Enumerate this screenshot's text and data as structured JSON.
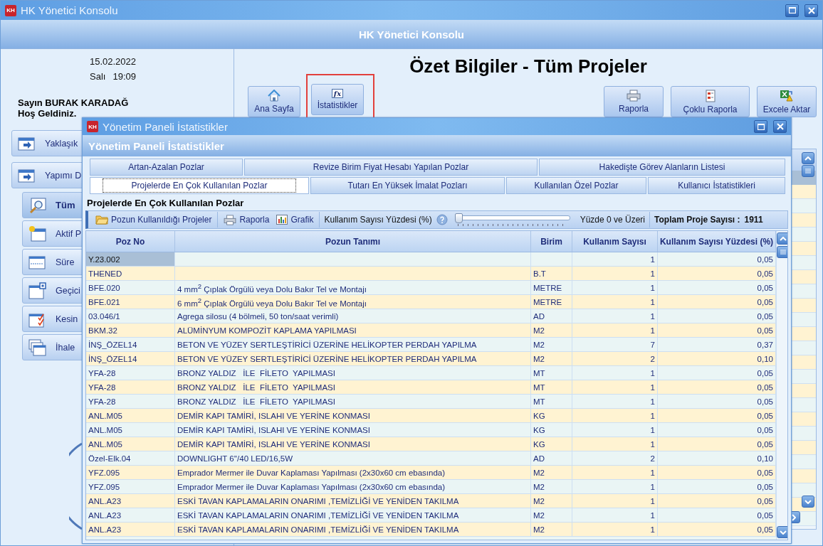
{
  "window": {
    "icon_text": "KH",
    "title": "HK Yönetici Konsolu"
  },
  "header": {
    "title": "HK Yönetici Konsolu"
  },
  "sidebar": {
    "date": "15.02.2022",
    "day": "Salı",
    "time": "19:09",
    "greeting": "Sayın BURAK KARADAĞ",
    "welcome": "Hoş Geldiniz.",
    "items": [
      {
        "label": "Yaklaşık",
        "selected": false
      },
      {
        "label": "Yapımı D",
        "selected": false,
        "children": [
          {
            "label": "Tüm",
            "selected": true
          },
          {
            "label": "Aktif P",
            "selected": false
          },
          {
            "label": "Süre",
            "selected": false
          },
          {
            "label": "Geçici",
            "selected": false
          },
          {
            "label": "Kesin",
            "selected": false
          },
          {
            "label": "İhale",
            "selected": false
          }
        ]
      }
    ]
  },
  "page": {
    "title": "Özet Bilgiler - Tüm Projeler",
    "left_buttons": [
      {
        "label": "Ana Sayfa"
      },
      {
        "label": "İstatistikler",
        "glyph": "fx",
        "highlighted": true
      }
    ],
    "right_buttons": [
      "Raporla",
      "Çoklu Raporla",
      "Excele Aktar"
    ]
  },
  "dialog": {
    "icon_text": "KH",
    "title": "Yönetim Paneli İstatistikler",
    "header": "Yönetim Paneli İstatistikler",
    "tab_rows": [
      [
        {
          "label": "Artan-Azalan Pozlar",
          "selected": false
        },
        {
          "label": "Revize Birim Fiyat Hesabı Yapılan Pozlar",
          "selected": false
        },
        {
          "label": "Hakedişte Görev Alanların Listesi",
          "selected": false
        }
      ],
      [
        {
          "label": "Projelerde En Çok Kullanılan Pozlar",
          "selected": true
        },
        {
          "label": "Tutarı En Yüksek İmalat Pozları",
          "selected": false
        },
        {
          "label": "Kullanılan Özel Pozlar",
          "selected": false
        },
        {
          "label": "Kullanıcı İstatistikleri",
          "selected": false
        }
      ]
    ],
    "section_title": "Projelerde En Çok Kullanılan Pozlar",
    "toolbar": {
      "buttons": [
        "Pozun Kullanıldığı Projeler",
        "Raporla",
        "Grafik"
      ],
      "percent_label": "Kullanım Sayısı Yüzdesi (%)",
      "slider": {
        "level": 0
      },
      "slider_reading": "Yüzde 0 ve Üzeri",
      "total_label": "Toplam Proje Sayısı :",
      "total_value": "1911"
    },
    "table": {
      "columns": [
        "Poz No",
        "Pozun Tanımı",
        "Birim",
        "Kullanım Sayısı",
        "Kullanım Sayısı Yüzdesi (%)"
      ],
      "rows": [
        {
          "cells": [
            "Y.23.002",
            null,
            null,
            "1",
            "0,05"
          ],
          "selected": true
        },
        {
          "cells": [
            "THENED",
            null,
            "B.T",
            "1",
            "0,05"
          ],
          "selected": false
        },
        {
          "cells": [
            "BFE.020",
            "4 mm$^{2}$ Çıplak Örgülü veya Dolu Bakır Tel ve Montajı",
            "METRE",
            "1",
            "0,05"
          ],
          "selected": false
        },
        {
          "cells": [
            "BFE.021",
            "6 mm$^{2}$ Çıplak Örgülü veya Dolu Bakır Tel ve Montajı",
            "METRE",
            "1",
            "0,05"
          ],
          "selected": false
        },
        {
          "cells": [
            "03.046/1",
            "Agrega silosu (4 bölmeli, 50 ton/saat verimli)",
            "AD",
            "1",
            "0,05"
          ],
          "selected": false
        },
        {
          "cells": [
            "BKM.32",
            "ALÜMİNYUM KOMPOZİT KAPLAMA YAPILMASI",
            "M2",
            "1",
            "0,05"
          ],
          "selected": false
        },
        {
          "cells": [
            "İNŞ_ÖZEL14",
            "BETON VE YÜZEY SERTLEŞTİRİCİ ÜZERİNE HELİKOPTER PERDAH YAPILMA",
            "M2",
            "7",
            "0,37"
          ],
          "selected": false
        },
        {
          "cells": [
            "İNŞ_ÖZEL14",
            "BETON VE YÜZEY SERTLEŞTİRİCİ ÜZERİNE HELİKOPTER PERDAH YAPILMA",
            "M2",
            "2",
            "0,10"
          ],
          "selected": false
        },
        {
          "cells": [
            "YFA-28",
            "BRONZ YALDIZ   İLE  FİLETO  YAPILMASI",
            "MT",
            "1",
            "0,05"
          ],
          "selected": false
        },
        {
          "cells": [
            "YFA-28",
            "BRONZ YALDIZ   İLE  FİLETO  YAPILMASI",
            "MT",
            "1",
            "0,05"
          ],
          "selected": false
        },
        {
          "cells": [
            "YFA-28",
            "BRONZ YALDIZ   İLE  FİLETO  YAPILMASI",
            "MT",
            "1",
            "0,05"
          ],
          "selected": false
        },
        {
          "cells": [
            "ANL.M05",
            "DEMİR KAPI TAMİRİ, ISLAHI VE YERİNE KONMASI",
            "KG",
            "1",
            "0,05"
          ],
          "selected": false
        },
        {
          "cells": [
            "ANL.M05",
            "DEMİR KAPI TAMİRİ, ISLAHI VE YERİNE KONMASI",
            "KG",
            "1",
            "0,05"
          ],
          "selected": false
        },
        {
          "cells": [
            "ANL.M05",
            "DEMİR KAPI TAMİRİ, ISLAHI VE YERİNE KONMASI",
            "KG",
            "1",
            "0,05"
          ],
          "selected": false
        },
        {
          "cells": [
            "Özel-Elk.04",
            "DOWNLIGHT 6''/40 LED/16,5W",
            "AD",
            "2",
            "0,10"
          ],
          "selected": false
        },
        {
          "cells": [
            "YFZ.095",
            "Emprador Mermer ile Duvar Kaplaması Yapılması (2x30x60 cm ebasında)",
            "M2",
            "1",
            "0,05"
          ],
          "selected": false
        },
        {
          "cells": [
            "YFZ.095",
            "Emprador Mermer ile Duvar Kaplaması Yapılması (2x30x60 cm ebasında)",
            "M2",
            "1",
            "0,05"
          ],
          "selected": false
        },
        {
          "cells": [
            "ANL.A23",
            "ESKİ TAVAN KAPLAMALARIN ONARIMI ,TEMİZLİĞİ VE YENİDEN TAKILMA",
            "M2",
            "1",
            "0,05"
          ],
          "selected": false
        },
        {
          "cells": [
            "ANL.A23",
            "ESKİ TAVAN KAPLAMALARIN ONARIMI ,TEMİZLİĞİ VE YENİDEN TAKILMA",
            "M2",
            "1",
            "0,05"
          ],
          "selected": false
        },
        {
          "cells": [
            "ANL.A23",
            "ESKİ TAVAN KAPLAMALARIN ONARIMI ,TEMİZLİĞİ VE YENİDEN TAKILMA",
            "M2",
            "1",
            "0,05"
          ],
          "selected": false
        }
      ]
    }
  }
}
